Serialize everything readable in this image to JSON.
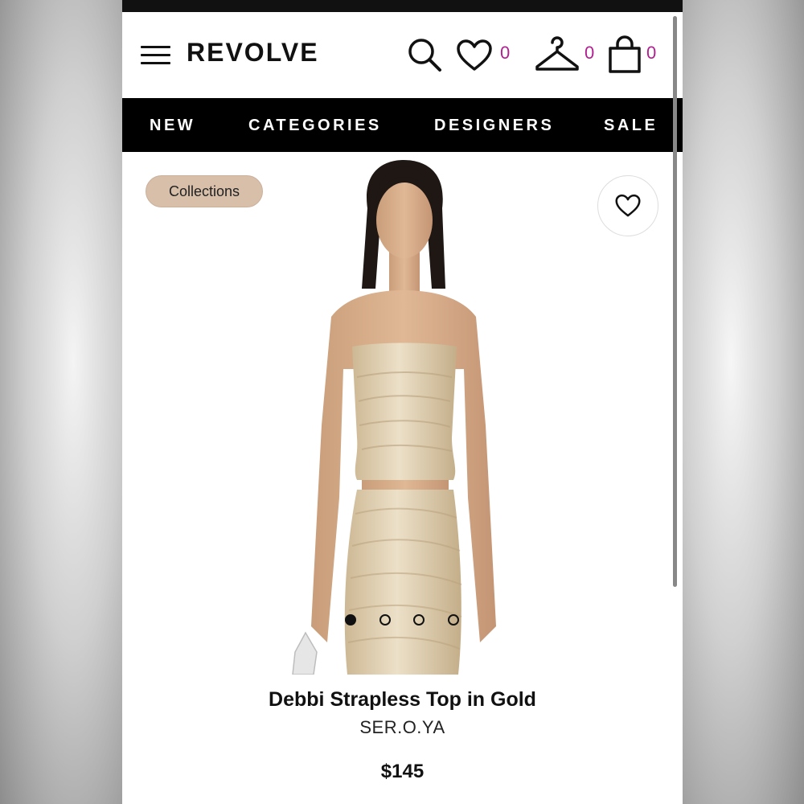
{
  "header": {
    "logo": "REVOLVE",
    "wishlist_count": "0",
    "account_count": "0",
    "bag_count": "0"
  },
  "nav": {
    "items": [
      "NEW",
      "CATEGORIES",
      "DESIGNERS",
      "SALE"
    ]
  },
  "product": {
    "badge": "Collections",
    "title": "Debbi Strapless Top in Gold",
    "brand": "SER.O.YA",
    "price": "$145",
    "carousel": {
      "total": 4,
      "active_index": 0
    }
  },
  "colors": {
    "accent": "#b0208f",
    "badge_bg": "#d8bfa9",
    "nav_bg": "#000000",
    "garment": "#d9c7a8"
  },
  "icons": [
    "menu-icon",
    "search-icon",
    "heart-icon",
    "hanger-icon",
    "bag-icon"
  ]
}
